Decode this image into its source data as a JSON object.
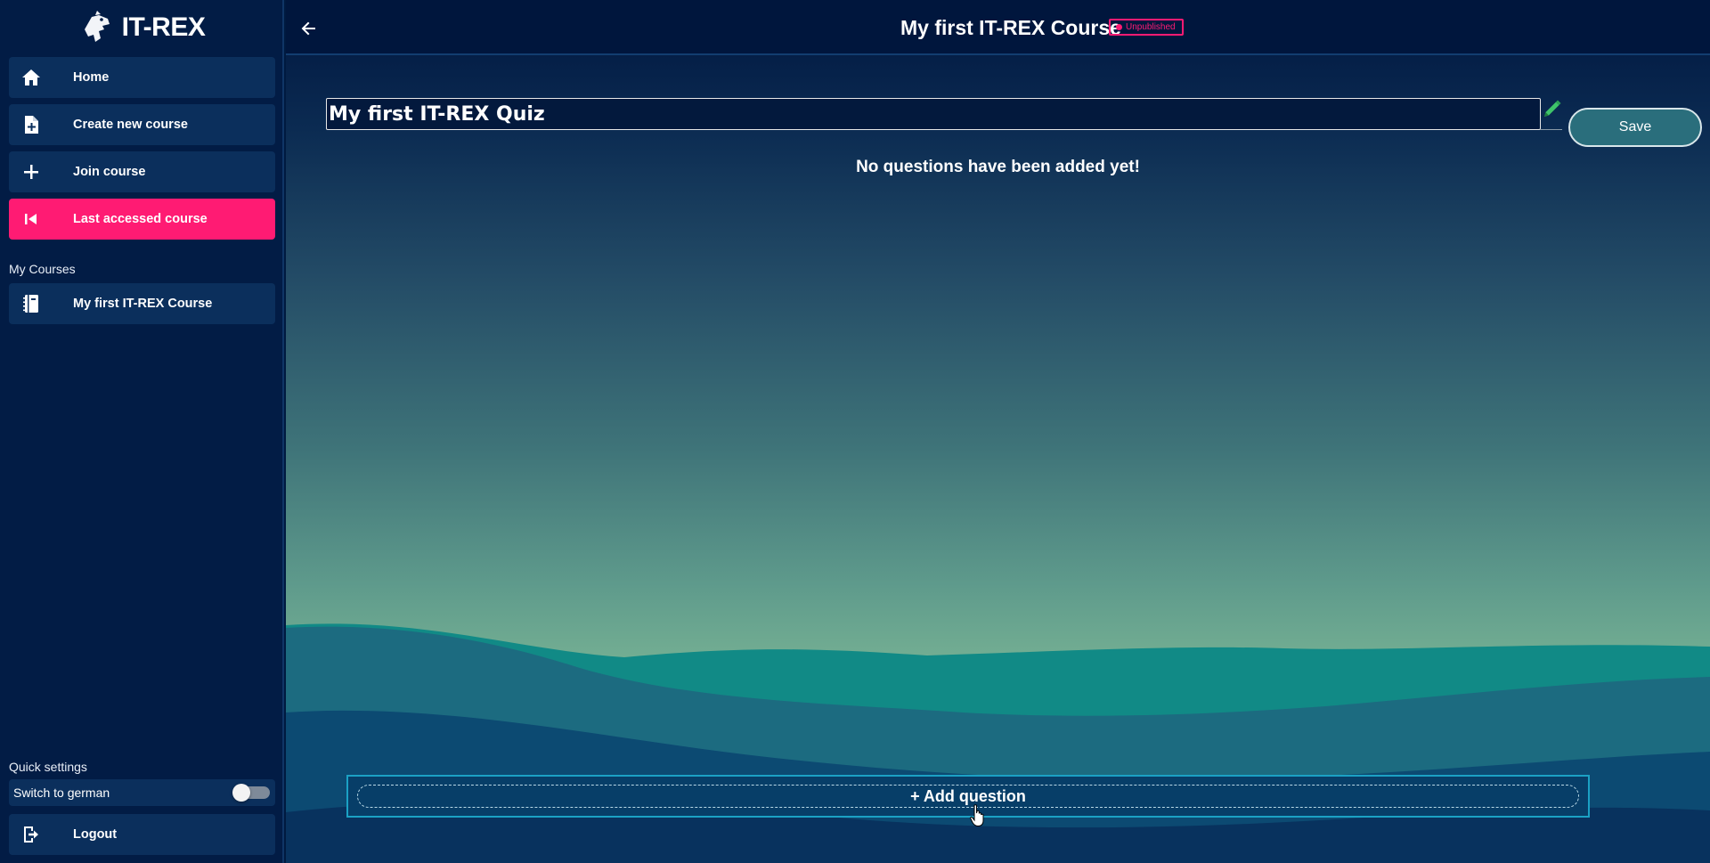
{
  "sidebar": {
    "app_name": "IT-REX",
    "nav": [
      {
        "label": "Home",
        "icon": "home-icon"
      },
      {
        "label": "Create new course",
        "icon": "file-plus-icon"
      },
      {
        "label": "Join course",
        "icon": "plus-icon"
      },
      {
        "label": "Last accessed course",
        "icon": "skip-back-icon",
        "active": true
      }
    ],
    "my_courses_heading": "My Courses",
    "courses": [
      {
        "label": "My first IT-REX Course",
        "icon": "notebook-icon"
      }
    ],
    "quick_settings_heading": "Quick settings",
    "language_toggle": {
      "label": "Switch to german",
      "checked": false
    },
    "logout_label": "Logout"
  },
  "header": {
    "course_title": "My first IT-REX Course",
    "status_badge": "Unpublished"
  },
  "editor": {
    "quiz_title_value": "My first IT-REX Quiz",
    "save_label": "Save",
    "empty_message": "No questions have been added yet!",
    "add_question_label": "+ Add question"
  },
  "colors": {
    "sidebar_bg": "#021c45",
    "nav_item_bg": "#0b2f5c",
    "accent_pink": "#ff1b73",
    "save_button_bg": "#2a6e7c",
    "add_question_border": "#1ba1c4"
  }
}
